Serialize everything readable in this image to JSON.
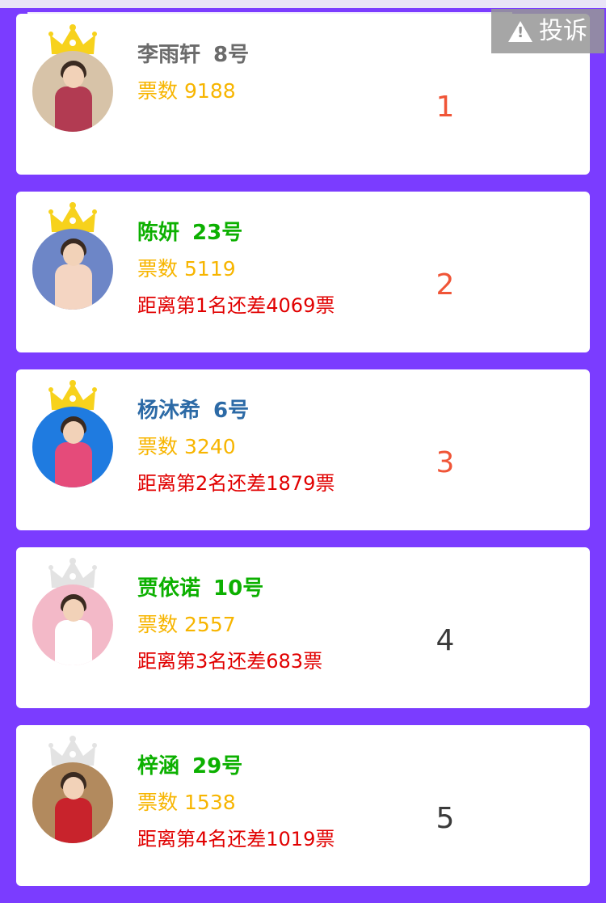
{
  "complain_label": "投诉",
  "entries": [
    {
      "name": "李雨轩",
      "number": "8号",
      "name_color": "#6b6b6b",
      "votes_label": "票数",
      "votes": "9188",
      "gap": "",
      "rank": "1",
      "rank_color": "#f05537",
      "crown_color": "#f7d21c",
      "crown_jewel": "#ffffff",
      "avatar_bg": "#d7c3a8",
      "avatar_cloth": "#b23b52"
    },
    {
      "name": "陈妍",
      "number": "23号",
      "name_color": "#0cb000",
      "votes_label": "票数",
      "votes": "5119",
      "gap": "距离第1名还差4069票",
      "rank": "2",
      "rank_color": "#f05537",
      "crown_color": "#f7d21c",
      "crown_jewel": "#ffffff",
      "avatar_bg": "#6d86c7",
      "avatar_cloth": "#f4d5c2"
    },
    {
      "name": "杨沐希",
      "number": "6号",
      "name_color": "#2c6aa6",
      "votes_label": "票数",
      "votes": "3240",
      "gap": "距离第2名还差1879票",
      "rank": "3",
      "rank_color": "#f05537",
      "crown_color": "#f7d21c",
      "crown_jewel": "#ffffff",
      "avatar_bg": "#1f7be0",
      "avatar_cloth": "#e54b7a"
    },
    {
      "name": "贾依诺",
      "number": "10号",
      "name_color": "#0cb000",
      "votes_label": "票数",
      "votes": "2557",
      "gap": "距离第3名还差683票",
      "rank": "4",
      "rank_color": "#3a3a3a",
      "crown_color": "#e3e3e3",
      "crown_jewel": "#ffffff",
      "avatar_bg": "#f3b9c8",
      "avatar_cloth": "#ffffff"
    },
    {
      "name": "梓涵",
      "number": "29号",
      "name_color": "#0cb000",
      "votes_label": "票数",
      "votes": "1538",
      "gap": "距离第4名还差1019票",
      "rank": "5",
      "rank_color": "#3a3a3a",
      "crown_color": "#e3e3e3",
      "crown_jewel": "#ffffff",
      "avatar_bg": "#b28a5e",
      "avatar_cloth": "#c8232c"
    }
  ]
}
